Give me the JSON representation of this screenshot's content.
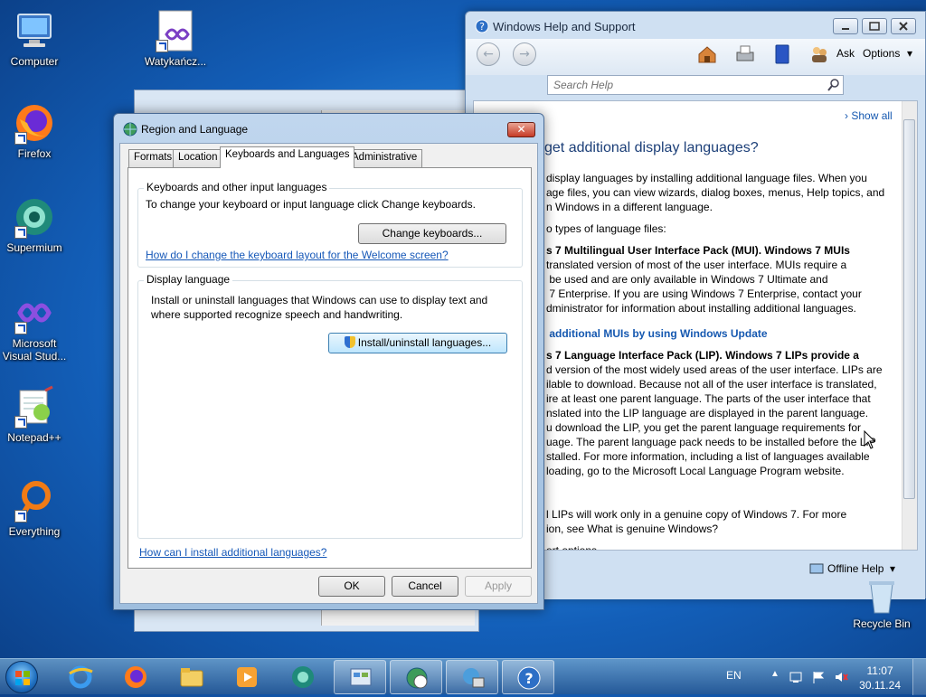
{
  "desktop": {
    "icons": [
      {
        "label": "Computer"
      },
      {
        "label": "Watykańcz..."
      },
      {
        "label": "Firefox"
      },
      {
        "label": "Supermium"
      },
      {
        "label": "Microsoft Visual Stud..."
      },
      {
        "label": "Notepad++"
      },
      {
        "label": "Everything"
      },
      {
        "label": "Recycle Bin"
      }
    ]
  },
  "help_window": {
    "title": "Windows Help and Support",
    "ask_label": "Ask",
    "options_label": "Options",
    "search_placeholder": "Search Help",
    "show_all": "Show all",
    "heading": "get additional display languages?",
    "lines": [
      "display languages by installing additional language files. When you",
      "age files, you can view wizards, dialog boxes, menus, Help topics, and",
      "n Windows in a different language.",
      "o types of language files:",
      "s 7 Multilingual User Interface Pack (MUI). Windows 7 MUIs",
      "translated version of most of the user interface. MUIs require a",
      " be used and are only available in Windows 7 Ultimate and",
      " 7 Enterprise. If you are using Windows 7 Enterprise, contact your",
      "dministrator for information about installing additional languages.",
      " additional MUIs by using Windows Update",
      "s 7 Language Interface Pack (LIP). Windows 7 LIPs provide a",
      "d version of the most widely used areas of the user interface. LIPs are",
      "ilable to download. Because not all of the user interface is translated,",
      "ire at least one parent language. The parts of the user interface that",
      "nslated into the LIP language are displayed in the parent language.",
      "u download the LIP, you get the parent language requirements for",
      "uage. The parent language pack needs to be installed before the LIP",
      "stalled. For more information, including a list of languages available",
      "loading, go to the Microsoft Local Language Program website.",
      "l LIPs will work only in a genuine copy of Windows 7. For more",
      "ion, see What is genuine Windows?"
    ],
    "support_options": "ort options",
    "offline_help": "Offline Help"
  },
  "dialog": {
    "title": "Region and Language",
    "tabs": [
      "Formats",
      "Location",
      "Keyboards and Languages",
      "Administrative"
    ],
    "active_tab": "Keyboards and Languages",
    "group1_title": "Keyboards and other input languages",
    "group1_text": "To change your keyboard or input language click Change keyboards.",
    "change_keyboards": "Change keyboards...",
    "welcome_link": "How do I change the keyboard layout for the Welcome screen?",
    "group2_title": "Display language",
    "group2_text1": "Install or uninstall languages that Windows can use to display text and",
    "group2_text2": "where supported recognize speech and handwriting.",
    "install_btn": "Install/uninstall languages...",
    "install_link": "How can I install additional languages?",
    "ok": "OK",
    "cancel": "Cancel",
    "apply": "Apply"
  },
  "taskbar": {
    "language": "EN",
    "time": "11:07",
    "date": "30.11.24"
  }
}
